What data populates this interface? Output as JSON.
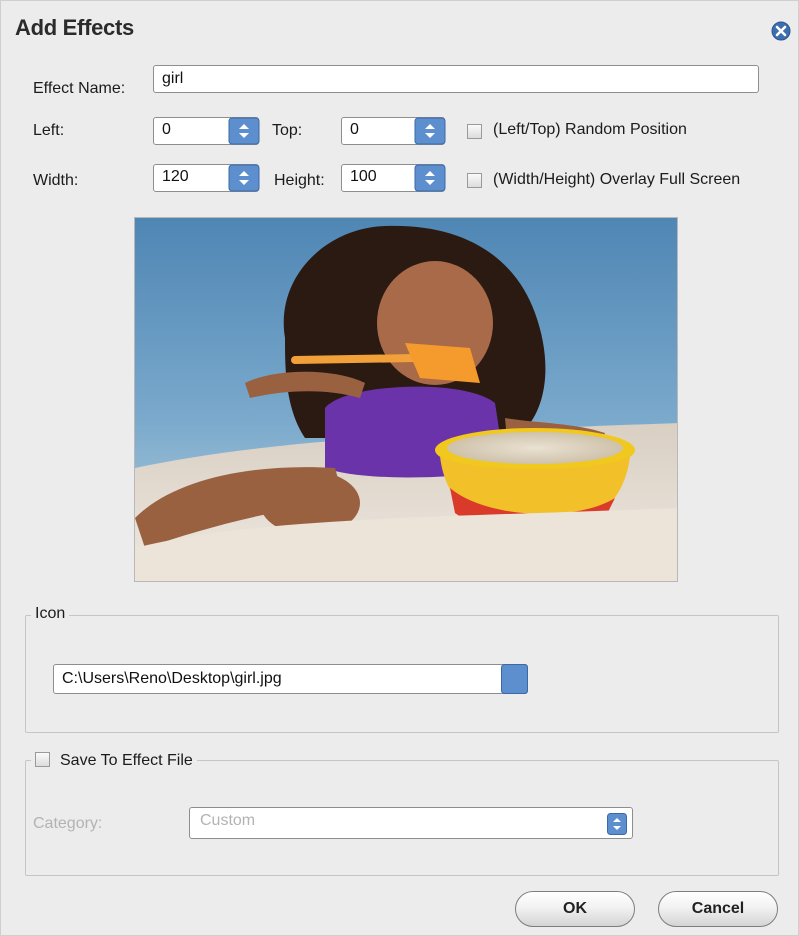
{
  "dialog": {
    "title": "Add Effects"
  },
  "fields": {
    "effect_name_label": "Effect Name:",
    "effect_name_value": "girl",
    "left_label": "Left:",
    "left_value": "0",
    "top_label": "Top:",
    "top_value": "0",
    "random_position_label": "(Left/Top) Random Position",
    "width_label": "Width:",
    "width_value": "120",
    "height_label": "Height:",
    "height_value": "100",
    "overlay_full_label": "(Width/Height) Overlay Full Screen"
  },
  "icon_group": {
    "legend": "Icon",
    "path_value": "C:\\Users\\Reno\\Desktop\\girl.jpg"
  },
  "save_group": {
    "legend": "Save To Effect File",
    "category_label": "Category:",
    "category_value": "Custom"
  },
  "buttons": {
    "ok": "OK",
    "cancel": "Cancel"
  },
  "checkboxes": {
    "random_position": false,
    "overlay_full": false,
    "save_to_effect_file": false
  },
  "icons": [
    "close-icon",
    "spin-up-down-icon",
    "folder-browse-icon",
    "dropdown-arrows-icon"
  ]
}
